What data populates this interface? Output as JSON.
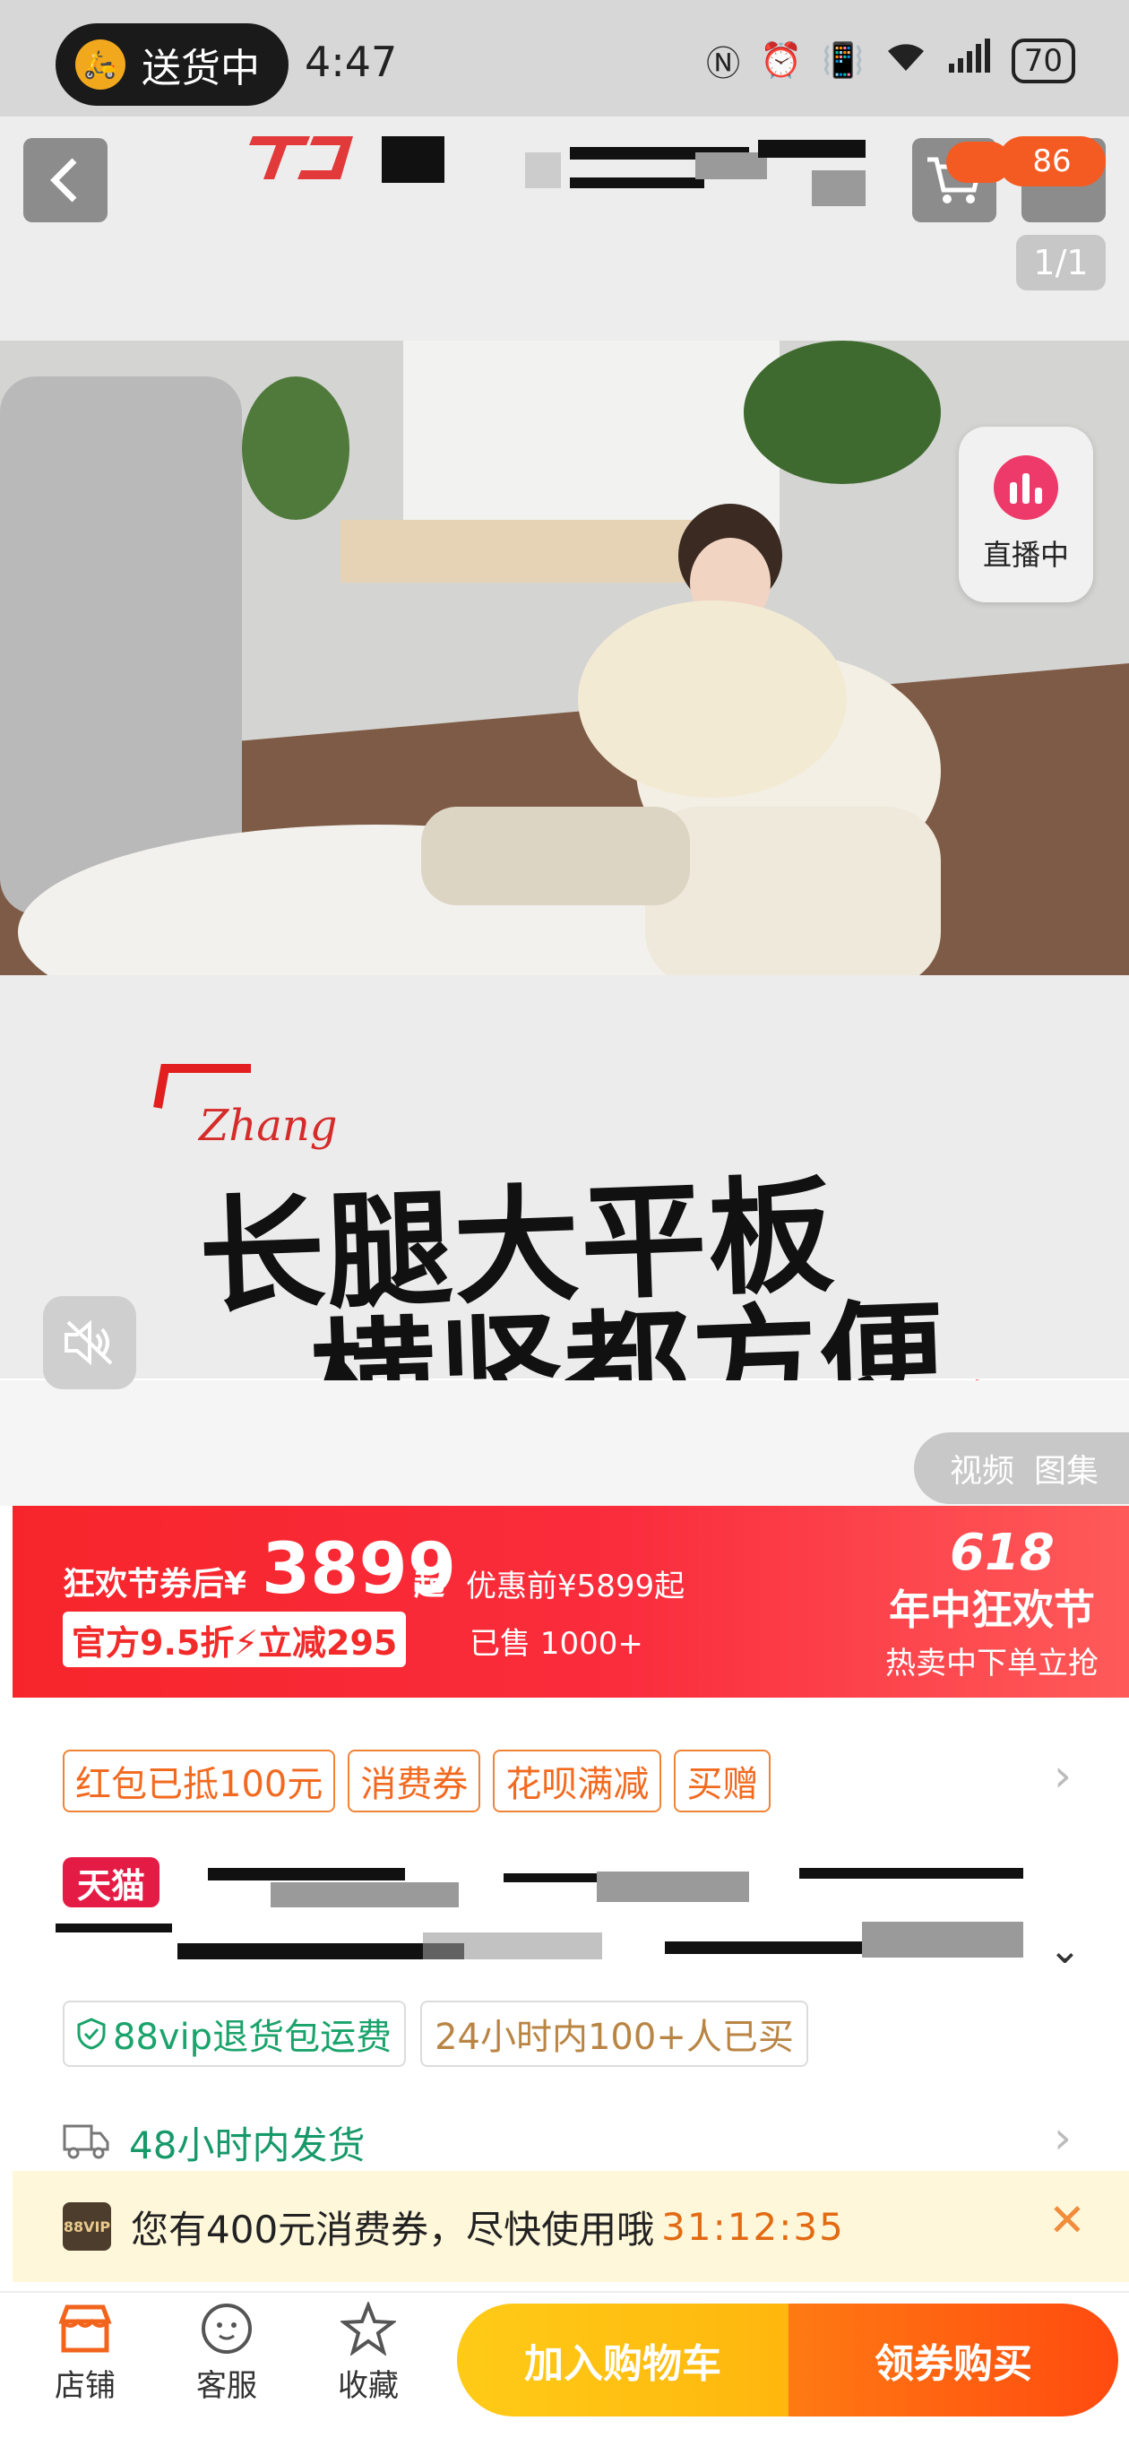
{
  "status_bar": {
    "delivery_label": "送货中",
    "time": "4:47",
    "battery": "70"
  },
  "header": {
    "cart_badge": "86",
    "image_counter": "1/1"
  },
  "video": {
    "live_label": "直播中",
    "slogan_line1": "长腿大平板",
    "slogan_line2": "横竖都方便",
    "slogan_script": "Zhang",
    "media_tabs": [
      "视频",
      "图集"
    ]
  },
  "price": {
    "label": "狂欢节券后",
    "currency": "¥",
    "amount": "3899",
    "suffix": "起",
    "original": "优惠前¥5899起",
    "discount_tag": "官方9.5折⚡立减295",
    "sold": "已售 1000+",
    "event_num": "618",
    "event_title": "年中狂欢节",
    "event_sub": "热卖中下单立抢"
  },
  "promos": [
    "红包已抵100元",
    "消费券",
    "花呗满减",
    "买赠"
  ],
  "title": {
    "store_badge": "天猫"
  },
  "services": {
    "return_shipping": "88vip退货包运费",
    "bought_recent": "24小时内100+人已买",
    "shipping": "48小时内发货"
  },
  "notice": {
    "vip_badge": "88VIP",
    "text": "您有400元消费券，尽快使用哦",
    "timer": "31:12:35"
  },
  "bottom_bar": {
    "store": "店铺",
    "service": "客服",
    "favorite": "收藏",
    "add_to_cart": "加入购物车",
    "buy": "领券购买"
  },
  "colors": {
    "price_red": "#f7252b",
    "promo_orange": "#f26a1f",
    "service_green": "#1aa36b",
    "cart_yellow": "#ffc414",
    "buy_orange": "#ff5a10"
  }
}
